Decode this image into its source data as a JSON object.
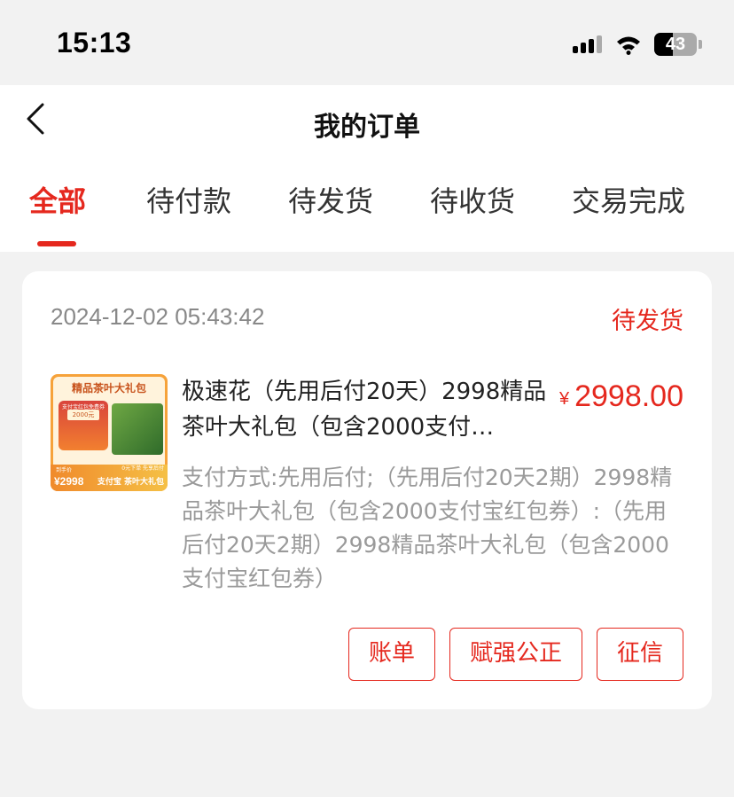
{
  "status_bar": {
    "time": "15:13",
    "battery": "43",
    "icons": [
      "signal-icon",
      "wifi-icon",
      "battery-icon"
    ]
  },
  "header": {
    "title": "我的订单",
    "back_icon": "chevron-left-icon"
  },
  "tabs": [
    {
      "label": "全部",
      "active": true
    },
    {
      "label": "待付款",
      "active": false
    },
    {
      "label": "待发货",
      "active": false
    },
    {
      "label": "待收货",
      "active": false
    },
    {
      "label": "交易完成",
      "active": false
    }
  ],
  "order": {
    "date": "2024-12-02 05:43:42",
    "status": "待发货",
    "product": {
      "name": "极速花（先用后付20天）2998精品茶叶大礼包（包含2000支付…",
      "currency": "¥",
      "price": "2998.00",
      "payment_info": "支付方式:先用后付;（先用后付20天2期）2998精品茶叶大礼包（包含2000支付宝红包券）:（先用后付20天2期）2998精品茶叶大礼包（包含2000支付宝红包券）",
      "thumbnail": {
        "title": "精品茶叶大礼包",
        "box_label": "支付宝红包免费券",
        "box_amount": "2000元",
        "price_label": "到手价",
        "price": "¥2998",
        "caption_small": "0元下单 先享后付",
        "caption": "支付宝 茶叶大礼包"
      }
    },
    "actions": [
      {
        "label": "账单"
      },
      {
        "label": "赋强公正"
      },
      {
        "label": "征信"
      }
    ]
  },
  "colors": {
    "accent": "#e5281e",
    "background": "#f2f2f2",
    "muted_text": "#9a9a9a"
  }
}
